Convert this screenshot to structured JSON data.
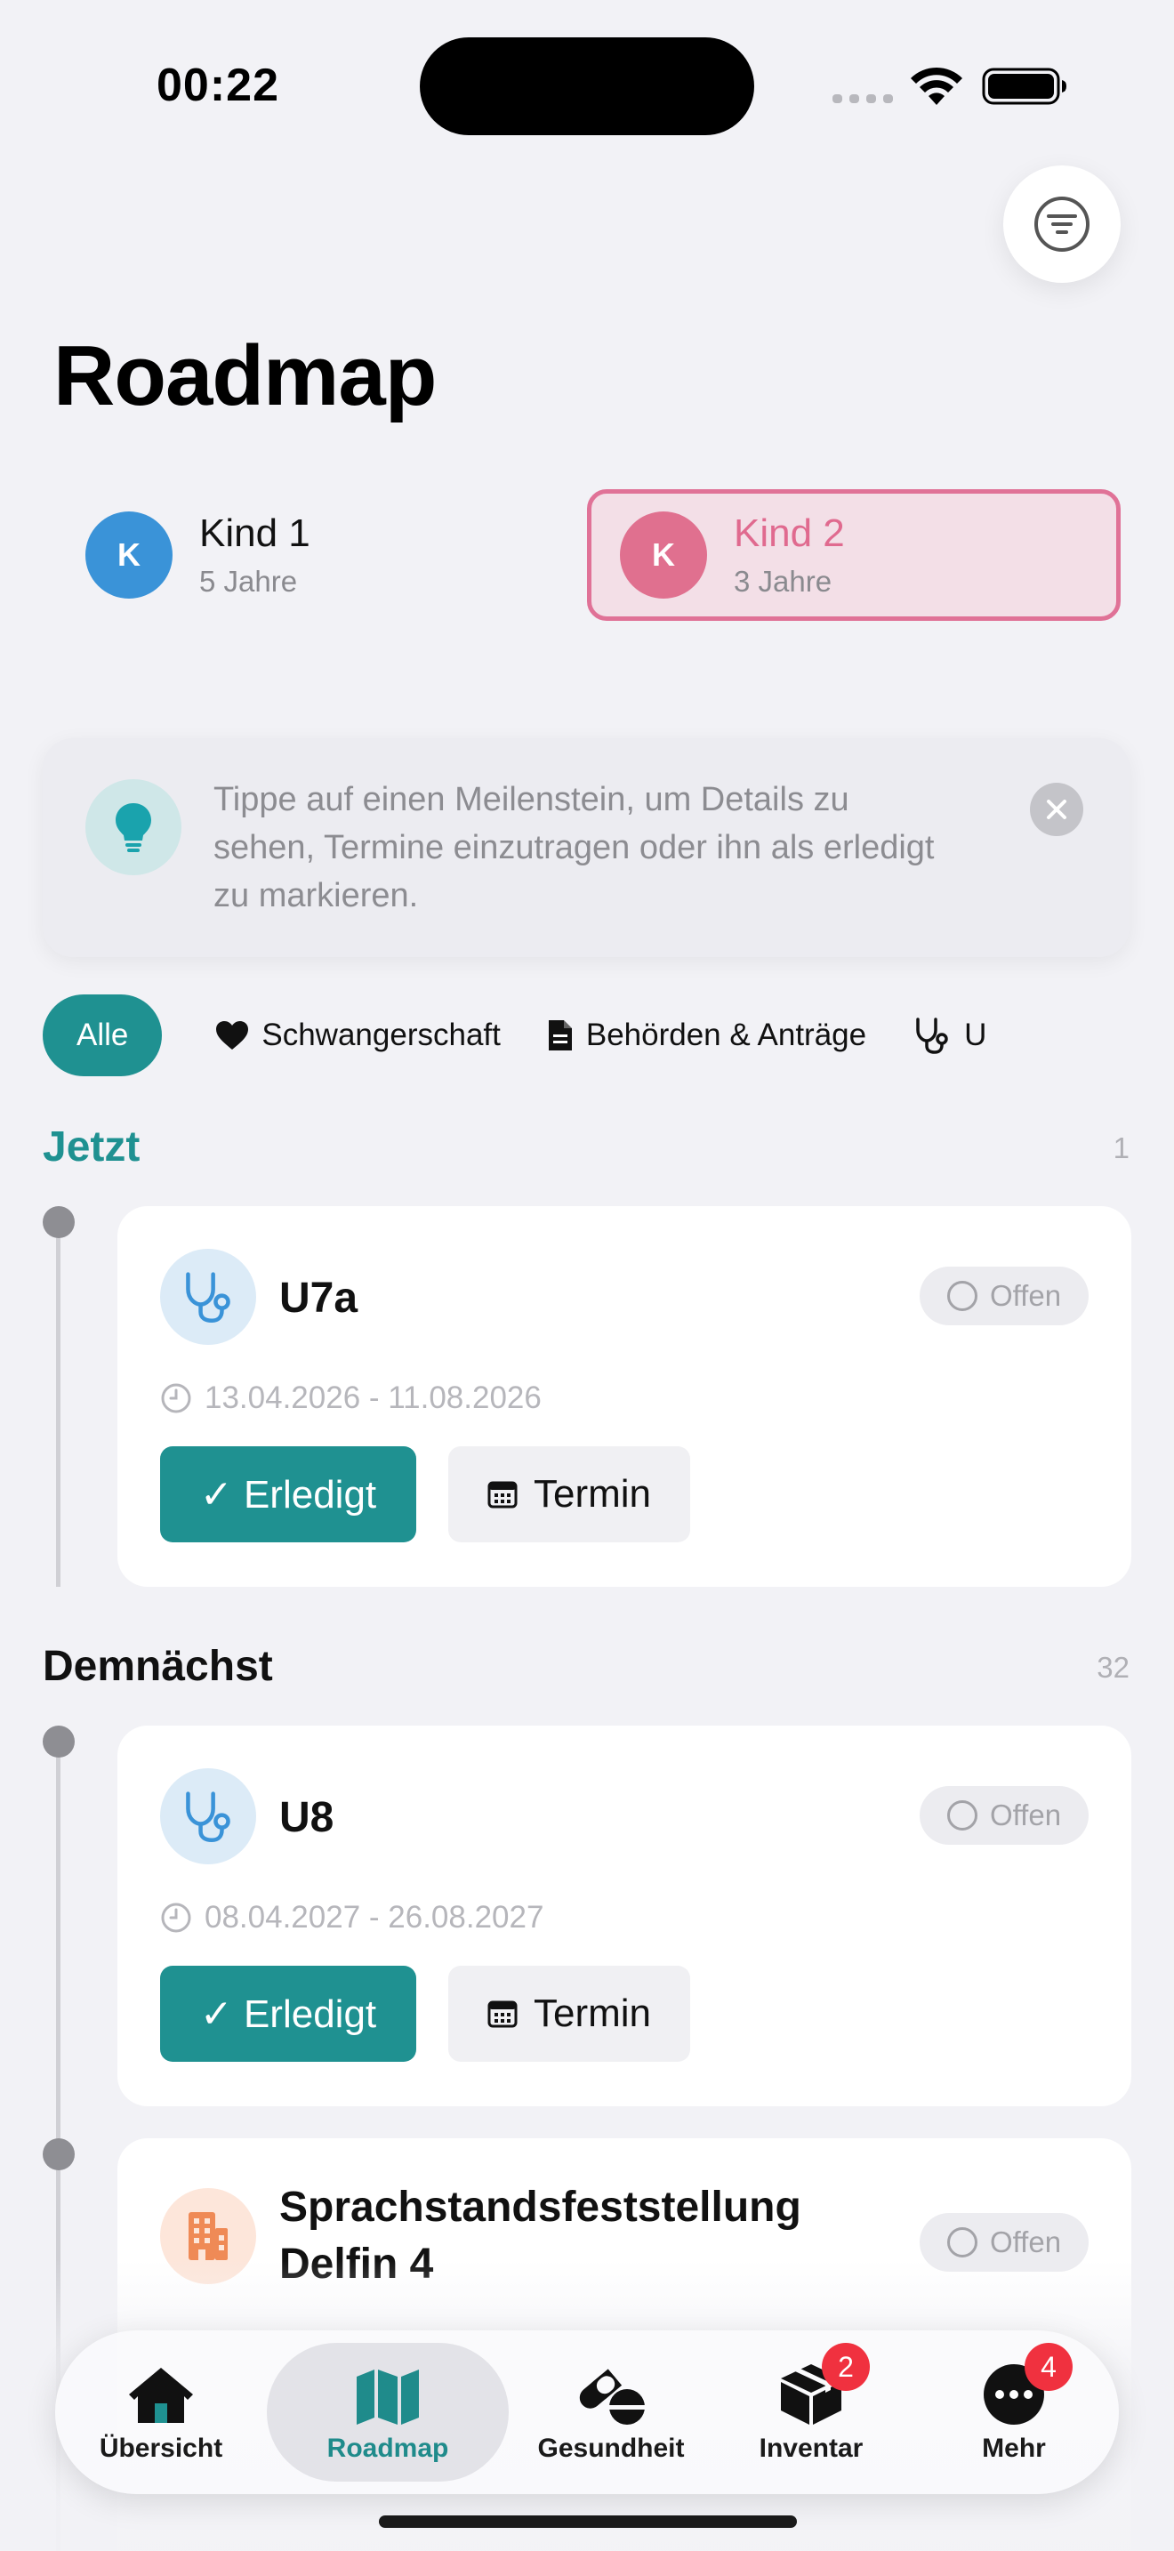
{
  "status_bar": {
    "time": "00:22"
  },
  "page": {
    "title": "Roadmap"
  },
  "children": [
    {
      "initial": "K",
      "name": "Kind 1",
      "age": "5 Jahre",
      "selected": false
    },
    {
      "initial": "K",
      "name": "Kind 2",
      "age": "3 Jahre",
      "selected": true
    }
  ],
  "tip": {
    "text": "Tippe auf einen Meilenstein, um Details zu sehen, Termine einzutragen oder ihn als erledigt zu markieren."
  },
  "categories": [
    {
      "label": "Alle",
      "icon": "none",
      "active": true
    },
    {
      "label": "Schwangerschaft",
      "icon": "heart-icon",
      "active": false
    },
    {
      "label": "Behörden & Anträge",
      "icon": "document-icon",
      "active": false
    },
    {
      "label": "U",
      "icon": "stethoscope-icon",
      "active": false
    }
  ],
  "sections": {
    "now": {
      "title": "Jetzt",
      "count": "1",
      "color": "#1f9191"
    },
    "upcoming": {
      "title": "Demnächst",
      "count": "32"
    }
  },
  "milestones": [
    {
      "title": "U7a",
      "status": "Offen",
      "dates": "13.04.2026 - 11.08.2026",
      "done_label": "✓ Erledigt",
      "appointment_label": "Termin",
      "icon": "stethoscope-icon"
    },
    {
      "title": "U8",
      "status": "Offen",
      "dates": "08.04.2027 - 26.08.2027",
      "done_label": "✓ Erledigt",
      "appointment_label": "Termin",
      "icon": "stethoscope-icon"
    },
    {
      "title": "Sprachstandsfeststellung Delfin 4",
      "status": "Offen",
      "icon": "building-icon"
    }
  ],
  "tabbar": {
    "tabs": [
      {
        "label": "Übersicht",
        "icon": "house-icon"
      },
      {
        "label": "Roadmap",
        "icon": "map-icon",
        "active": true
      },
      {
        "label": "Gesundheit",
        "icon": "pills-icon"
      },
      {
        "label": "Inventar",
        "icon": "box-icon",
        "badge": "2"
      },
      {
        "label": "Mehr",
        "icon": "ellipsis-icon",
        "badge": "4"
      }
    ]
  },
  "colors": {
    "accent": "#1f9191",
    "pink": "#e0708f",
    "blue": "#3a93d8",
    "badge_red": "#f0313f"
  }
}
